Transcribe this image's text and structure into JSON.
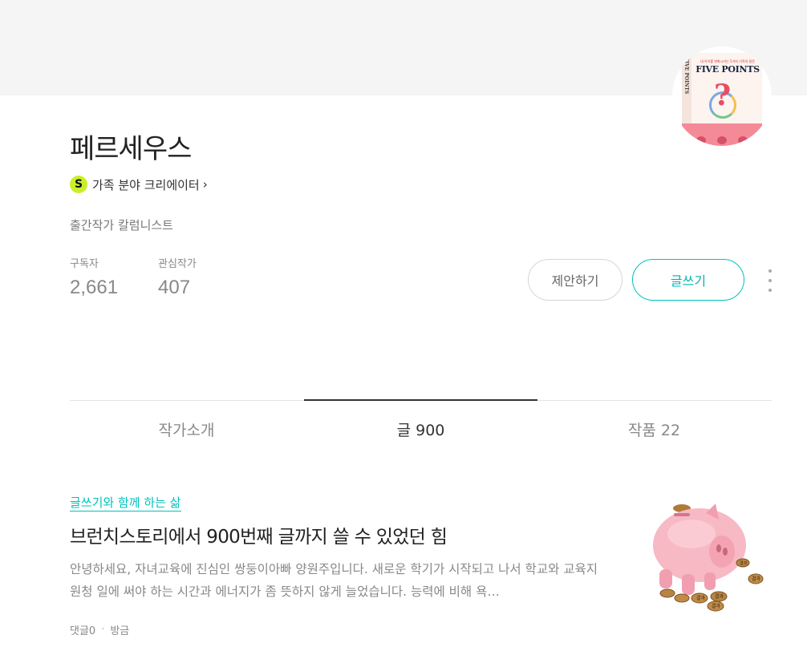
{
  "profile": {
    "name": "페르세우스",
    "creator_badge": "S",
    "creator_label": "가족 분야 크리에이터",
    "description": "출간작가 칼럼니스트",
    "cover_book": {
      "spine": "FIVE POINTS",
      "kicker": "내 아이를 변화시키는 5가지 기적의 질문",
      "title": "FIVE POINTS"
    }
  },
  "stats": [
    {
      "label": "구독자",
      "value": "2,661"
    },
    {
      "label": "관심작가",
      "value": "407"
    }
  ],
  "buttons": {
    "propose": "제안하기",
    "write": "글쓰기"
  },
  "tabs": [
    {
      "label": "작가소개",
      "active": false
    },
    {
      "label": "글 900",
      "active": true
    },
    {
      "label": "작품 22",
      "active": false
    }
  ],
  "post": {
    "category": "글쓰기와 함께 하는 삶",
    "title": "브런치스토리에서 900번째 글까지 쓸 수 있었던 힘",
    "excerpt": "안녕하세요, 자녀교육에 진심인 쌍둥이아빠 양원주입니다. 새로운 학기가 시작되고 나서 학교와 교육지원청 일에 써야 하는 시간과 에너지가 좀 뜻하지 않게 늘었습니다. 능력에 비해 욕…",
    "comments": "댓글0",
    "time": "방금",
    "coin_labels": [
      "결과",
      "결과",
      "결과",
      "결과",
      "결과"
    ]
  },
  "colors": {
    "accent": "#00c3bd",
    "badge": "#c9ef2a",
    "cover_bg": "#f5f5f5"
  }
}
